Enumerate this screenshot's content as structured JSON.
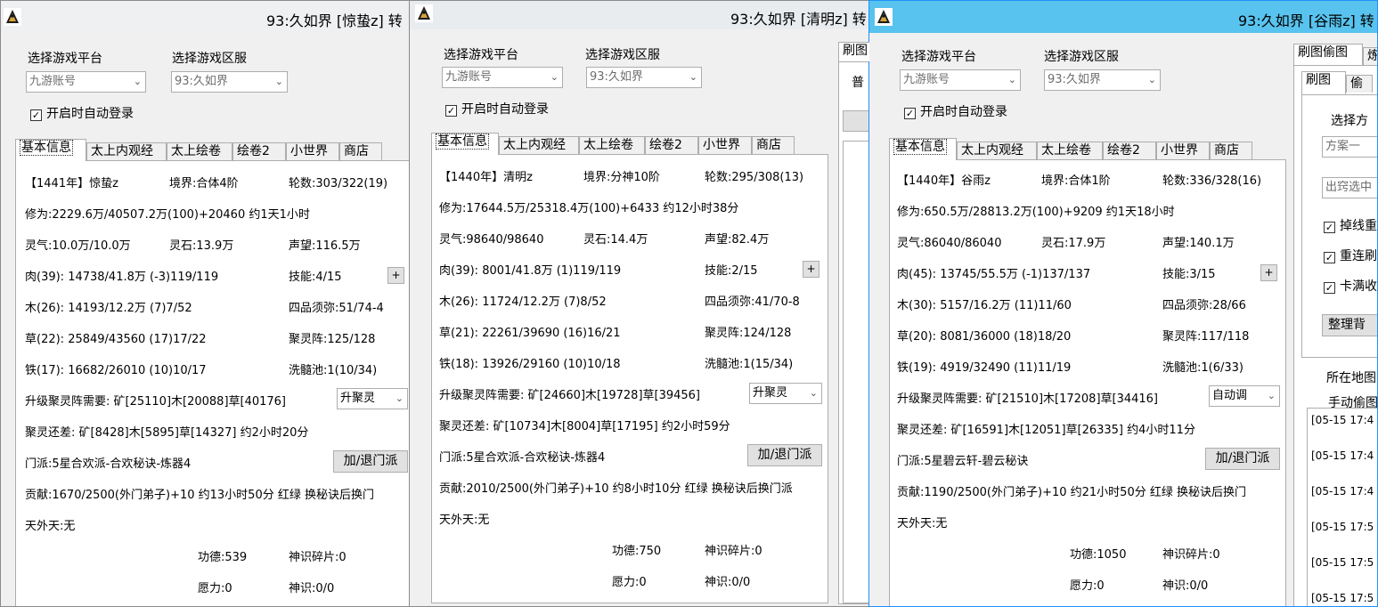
{
  "windows": [
    {
      "title": "93:久如界 [惊蛰z] 转",
      "platform_label": "选择游戏平台",
      "platform_value": "九游账号",
      "server_label": "选择游戏区服",
      "server_value": "93:久如界",
      "autologin_label": "开启时自动登录",
      "tabs": [
        "基本信息",
        "太上内观经",
        "太上绘卷",
        "绘卷2",
        "小世界",
        "商店"
      ],
      "info": {
        "name": "【1441年】惊蛰z",
        "realm": "境界:合体4阶",
        "rounds": "轮数:303/322(19)",
        "cultivation": "修为:2229.6万/40507.2万(100)+20460 约1天1小时",
        "qi": "灵气:10.0万/10.0万",
        "stone": "灵石:13.9万",
        "fame": "声望:116.5万",
        "flesh": "肉(39): 14738/41.8万 (-3)119/119",
        "skill": "技能:4/15",
        "wood": "木(26): 14193/12.2万 (7)7/52",
        "sumeru": "四品须弥:51/74-4",
        "grass": "草(22): 25849/43560 (17)17/22",
        "array": "聚灵阵:125/128",
        "iron": "铁(17): 16682/26010 (10)10/17",
        "pool": "洗髓池:1(10/34)",
        "upgrade": "升级聚灵阵需要: 矿[25110]木[20088]草[40176]",
        "upgrade_select": "升聚灵",
        "shortage": "聚灵还差: 矿[8428]木[5895]草[14327] 约2小时20分",
        "sect": "门派:5星合欢派-合欢秘诀-炼器4",
        "sect_btn": "加/退门派",
        "contrib": "贡献:1670/2500(外门弟子)+10 约13小时50分 红绿 换秘诀后换门",
        "sky": "天外天:无",
        "merit": "功德:539",
        "shard": "神识碎片:0",
        "will": "愿力:0",
        "sense": "神识:0/0"
      }
    },
    {
      "title": "93:久如界 [清明z] 转",
      "platform_label": "选择游戏平台",
      "platform_value": "九游账号",
      "server_label": "选择游戏区服",
      "server_value": "93:久如界",
      "autologin_label": "开启时自动登录",
      "tabs": [
        "基本信息",
        "太上内观经",
        "太上绘卷",
        "绘卷2",
        "小世界",
        "商店"
      ],
      "side_tab": "刷图",
      "side_text": "普",
      "info": {
        "name": "【1440年】清明z",
        "realm": "境界:分神10阶",
        "rounds": "轮数:295/308(13)",
        "cultivation": "修为:17644.5万/25318.4万(100)+6433 约12小时38分",
        "qi": "灵气:98640/98640",
        "stone": "灵石:14.4万",
        "fame": "声望:82.4万",
        "flesh": "肉(39): 8001/41.8万 (1)119/119",
        "skill": "技能:2/15",
        "wood": "木(26): 11724/12.2万 (7)8/52",
        "sumeru": "四品须弥:41/70-8",
        "grass": "草(21): 22261/39690 (16)16/21",
        "array": "聚灵阵:124/128",
        "iron": "铁(18): 13926/29160 (10)10/18",
        "pool": "洗髓池:1(15/34)",
        "upgrade": "升级聚灵阵需要: 矿[24660]木[19728]草[39456]",
        "upgrade_select": "升聚灵",
        "shortage": "聚灵还差: 矿[10734]木[8004]草[17195] 约2小时59分",
        "sect": "门派:5星合欢派-合欢秘诀-炼器4",
        "sect_btn": "加/退门派",
        "contrib": "贡献:2010/2500(外门弟子)+10 约8小时10分 红绿 换秘诀后换门派",
        "sky": "天外天:无",
        "merit": "功德:750",
        "shard": "神识碎片:0",
        "will": "愿力:0",
        "sense": "神识:0/0"
      }
    },
    {
      "title": "93:久如界 [谷雨z] 转",
      "platform_label": "选择游戏平台",
      "platform_value": "九游账号",
      "server_label": "选择游戏区服",
      "server_value": "93:久如界",
      "autologin_label": "开启时自动登录",
      "tabs": [
        "基本信息",
        "太上内观经",
        "太上绘卷",
        "绘卷2",
        "小世界",
        "商店"
      ],
      "info": {
        "name": "【1440年】谷雨z",
        "realm": "境界:合体1阶",
        "rounds": "轮数:336/328(16)",
        "cultivation": "修为:650.5万/28813.2万(100)+9209 约1天18小时",
        "qi": "灵气:86040/86040",
        "stone": "灵石:17.9万",
        "fame": "声望:140.1万",
        "flesh": "肉(45): 13745/55.5万 (-1)137/137",
        "skill": "技能:3/15",
        "wood": "木(30): 5157/16.2万 (11)11/60",
        "sumeru": "四品须弥:28/66",
        "grass": "草(20): 8081/36000 (18)18/20",
        "array": "聚灵阵:117/118",
        "iron": "铁(19): 4919/32490 (11)11/19",
        "pool": "洗髓池:1(6/33)",
        "upgrade": "升级聚灵阵需要: 矿[21510]木[17208]草[34416]",
        "upgrade_select": "自动调",
        "shortage": "聚灵还差: 矿[16591]木[12051]草[26335] 约4小时11分",
        "sect": "门派:5星碧云轩-碧云秘诀",
        "sect_btn": "加/退门派",
        "contrib": "贡献:1190/2500(外门弟子)+10 约21小时50分 红绿 换秘诀后换门",
        "sky": "天外天:无",
        "merit": "功德:1050",
        "shard": "神识碎片:0",
        "will": "愿力:0",
        "sense": "神识:0/0"
      },
      "right": {
        "outer_tab1": "刷图偷图",
        "outer_tab2": "炼",
        "inner_tab1": "刷图",
        "inner_tab2": "偷",
        "choose": "选择方",
        "plan": "方案一",
        "chest": "出窍选中",
        "chk1": "掉线重",
        "chk2": "重连刷",
        "chk3": "卡满收",
        "tidy_btn": "整理背",
        "map": "所在地图",
        "manual": "手动偷图",
        "logs": [
          "[05-15 17:4",
          "[05-15 17:4",
          "[05-15 17:4",
          "[05-15 17:5",
          "[05-15 17:5",
          "[05-15 17:5"
        ]
      }
    }
  ]
}
